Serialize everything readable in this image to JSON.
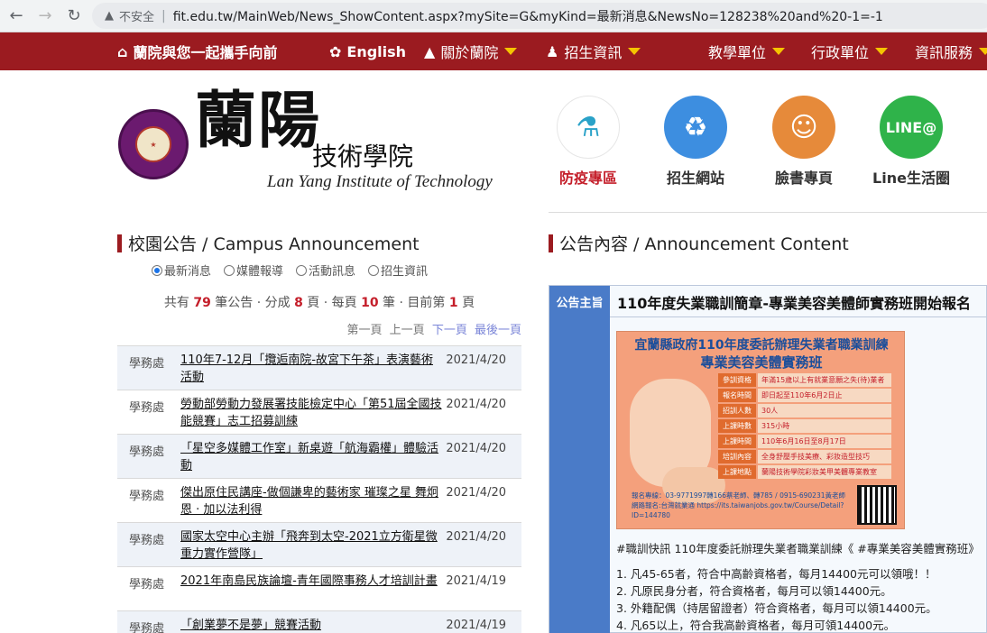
{
  "browser": {
    "insecure_label": "不安全",
    "url": "fit.edu.tw/MainWeb/News_ShowContent.aspx?mySite=G&myKind=最新消息&NewsNo=128238%20and%20-1=-1"
  },
  "topnav": {
    "home": "蘭院與您一起攜手向前",
    "english": "English",
    "about": "關於蘭院",
    "admission": "招生資訊",
    "teaching": "教學單位",
    "admin": "行政單位",
    "service": "資訊服務"
  },
  "logo": {
    "big": "蘭陽",
    "cn": "技術學院",
    "en": "Lan Yang Institute of Technology",
    "seal_text": "蘭陽技術學院"
  },
  "quicklinks": [
    {
      "label": "防疫專區",
      "icon": "test-tube-icon"
    },
    {
      "label": "招生網站",
      "icon": "globe-recycle-icon"
    },
    {
      "label": "臉書專頁",
      "icon": "facebook-photo-icon"
    },
    {
      "label": "Line生活圈",
      "icon": "line-icon"
    }
  ],
  "left": {
    "title": "校園公告 / Campus Announcement",
    "filters": [
      "最新消息",
      "媒體報導",
      "活動訊息",
      "招生資訊"
    ],
    "summary": {
      "p1": "共有 ",
      "total": "79",
      "p2": " 筆公告 · 分成 ",
      "pages": "8",
      "p3": " 頁 · 每頁 ",
      "per": "10",
      "p4": " 筆 · 目前第 ",
      "current": "1",
      "p5": " 頁"
    },
    "pager": {
      "first": "第一頁",
      "prev": "上一頁",
      "next": "下一頁",
      "last": "最後一頁"
    },
    "rows": [
      {
        "dept": "學務處",
        "title": "110年7-12月「攬逅南院-故宮下午茶」表演藝術活動",
        "date": "2021/4/20"
      },
      {
        "dept": "學務處",
        "title": "勞動部勞動力發展署技能檢定中心「第51屆全國技能競賽」志工招募訓練",
        "date": "2021/4/20"
      },
      {
        "dept": "學務處",
        "title": "「星空多媒體工作室」新桌遊「航海霸權」體驗活動",
        "date": "2021/4/20"
      },
      {
        "dept": "學務處",
        "title": "傑出原住民講座-做個謙卑的藝術家 璀璨之星 舞炯恩 · 加以法利得",
        "date": "2021/4/20"
      },
      {
        "dept": "學務處",
        "title": "國家太空中心主辦「飛奔到太空-2021立方衛星微重力實作營隊」",
        "date": "2021/4/20"
      },
      {
        "dept": "學務處",
        "title": "2021年南島民族論壇-青年國際事務人才培訓計畫",
        "date": "2021/4/19"
      },
      {
        "dept": "學務處",
        "title": "「創業夢不是夢」競賽活動",
        "date": "2021/4/19"
      }
    ]
  },
  "right": {
    "title": "公告內容 / Announcement Content",
    "label": "公告主旨",
    "subject": "110年度失業職訓簡章-專業美容美體師實務班開始報名",
    "poster": {
      "line1": "宜蘭縣政府110年度委託辦理失業者職業訓練",
      "line2": "專業美容美體實務班",
      "rows": [
        {
          "k": "參訓資格",
          "v": "年滿15歲以上有就業意願之失(待)業者"
        },
        {
          "k": "報名時間",
          "v": "即日起至110年6月2日止"
        },
        {
          "k": "招訓人數",
          "v": "30人"
        },
        {
          "k": "上課時數",
          "v": "315小時"
        },
        {
          "k": "上課時間",
          "v": "110年6月16日至8月17日"
        },
        {
          "k": "培訓內容",
          "v": "全身舒壓手技美療、彩妝造型技巧"
        },
        {
          "k": "上課地點",
          "v": "蘭陽技術學院彩妝美甲美體專業教室"
        }
      ],
      "footer": "報名專線：03-9771997轉166蔡老師、轉785 / 0915-690231黃老師 網路報名:台灣就業通 https://its.taiwanjobs.gov.tw/Course/Detail?ID=144780"
    },
    "body": [
      "#職訓快訊 110年度委託辦理失業者職業訓練《 #專業美容美體實務班》",
      "1. 凡45-65者，符合中高齡資格者，每月14400元可以領哦！！",
      "2. 凡原民身分者，符合資格者，每月可以領14400元。",
      "3. 外籍配偶（持居留證者）符合資格者，每月可以領14400元。",
      "4. 凡65以上，符合我高齡資格者，每月可領14400元。"
    ]
  },
  "colors": {
    "brand_red": "#9b1b20",
    "accent_yellow": "#f5c400",
    "label_blue": "#4a7bc8",
    "highlight_red": "#c41e2a"
  }
}
